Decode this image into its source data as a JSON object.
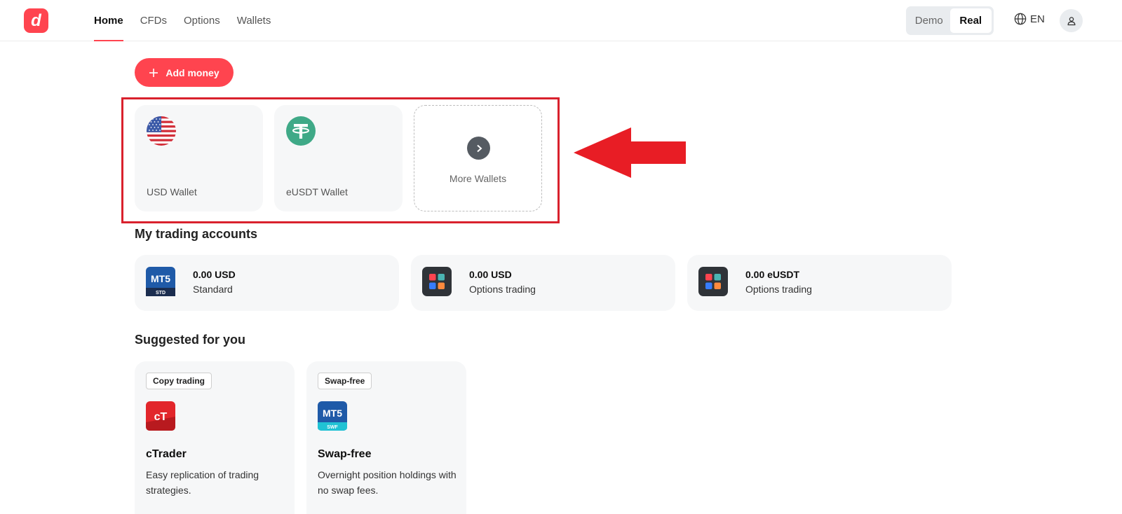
{
  "header": {
    "nav": [
      {
        "label": "Home",
        "active": true
      },
      {
        "label": "CFDs",
        "active": false
      },
      {
        "label": "Options",
        "active": false
      },
      {
        "label": "Wallets",
        "active": false
      }
    ],
    "mode_toggle": {
      "options": [
        "Demo",
        "Real"
      ],
      "selected": "Real"
    },
    "language": "EN"
  },
  "actions": {
    "add_money_label": "Add money"
  },
  "wallets": [
    {
      "label": "USD Wallet",
      "icon": "us-flag-icon"
    },
    {
      "label": "eUSDT Wallet",
      "icon": "tether-icon"
    }
  ],
  "more_wallets_label": "More Wallets",
  "trading_accounts": {
    "title": "My trading accounts",
    "items": [
      {
        "amount": "0.00 USD",
        "type": "Standard",
        "icon": "mt5-std-icon"
      },
      {
        "amount": "0.00 USD",
        "type": "Options trading",
        "icon": "options-app-icon"
      },
      {
        "amount": "0.00 eUSDT",
        "type": "Options trading",
        "icon": "options-app-icon"
      }
    ]
  },
  "suggested": {
    "title": "Suggested for you",
    "items": [
      {
        "badge": "Copy trading",
        "title": "cTrader",
        "desc": "Easy replication of trading strategies.",
        "icon": "ctrader-icon"
      },
      {
        "badge": "Swap-free",
        "title": "Swap-free",
        "desc": "Overnight position holdings with no swap fees.",
        "icon": "mt5-swf-icon"
      }
    ]
  },
  "icon_labels": {
    "mt5": "MT5",
    "std": "STD",
    "swf": "SWF",
    "ctrader": "cT",
    "logo": "d"
  },
  "colors": {
    "brand_red": "#ff444f",
    "highlight_red": "#d9212d",
    "card_bg": "#f6f7f8"
  }
}
